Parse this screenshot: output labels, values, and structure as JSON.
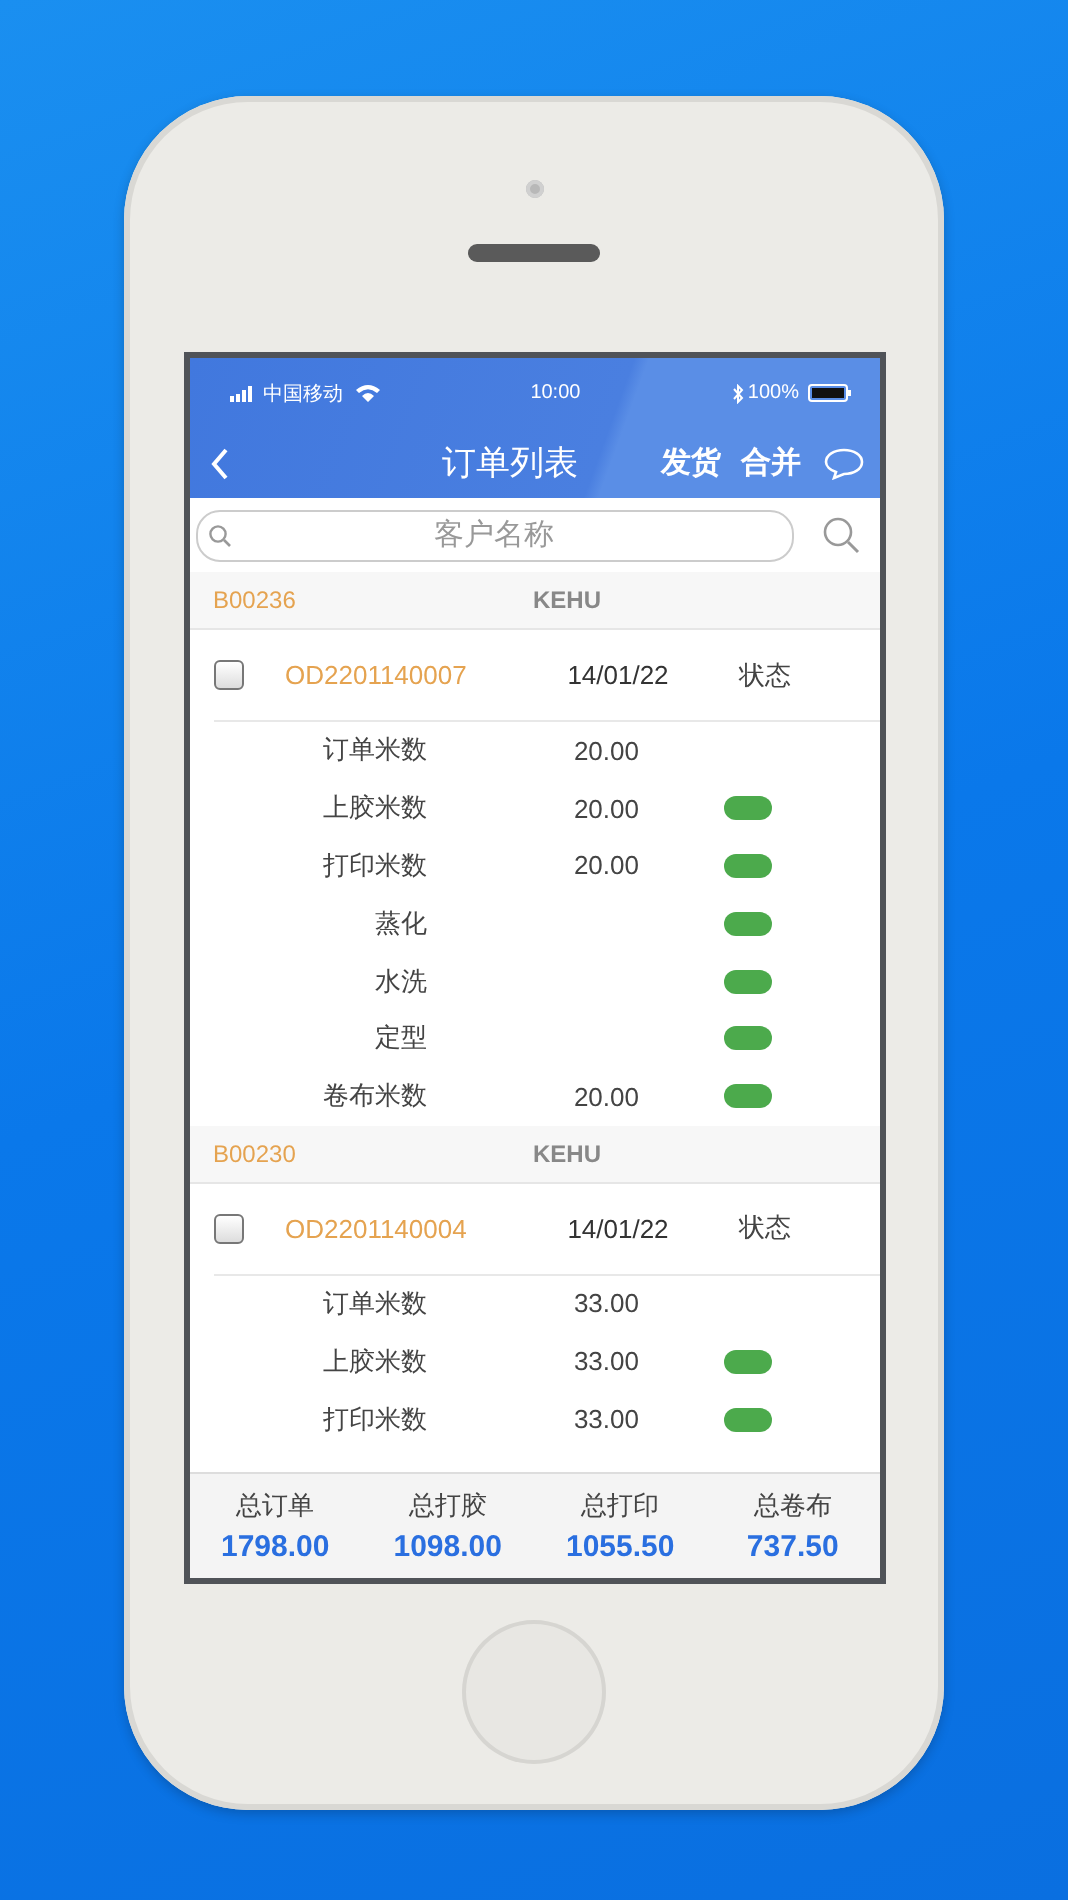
{
  "status_bar": {
    "carrier": "中国移动",
    "time": "10:00",
    "battery": "100%"
  },
  "nav": {
    "title": "订单列表",
    "actions": [
      "发货",
      "合并"
    ]
  },
  "search": {
    "placeholder": "客户名称"
  },
  "groups": [
    {
      "code": "B00236",
      "customer": "KEHU",
      "order": {
        "number": "OD2201140007",
        "date": "14/01/22",
        "status_label": "状态",
        "checked": false
      },
      "rows": [
        {
          "label": "订单米数",
          "value": "20.00",
          "done": false
        },
        {
          "label": "上胶米数",
          "value": "20.00",
          "done": true
        },
        {
          "label": "打印米数",
          "value": "20.00",
          "done": true
        },
        {
          "label": "蒸化",
          "done": true
        },
        {
          "label": "水洗",
          "done": true
        },
        {
          "label": "定型",
          "done": true
        },
        {
          "label": "卷布米数",
          "value": "20.00",
          "done": true
        }
      ]
    },
    {
      "code": "B00230",
      "customer": "KEHU",
      "order": {
        "number": "OD2201140004",
        "date": "14/01/22",
        "status_label": "状态",
        "checked": false
      },
      "rows": [
        {
          "label": "订单米数",
          "value": "33.00",
          "done": false
        },
        {
          "label": "上胶米数",
          "value": "33.00",
          "done": true
        },
        {
          "label": "打印米数",
          "value": "33.00",
          "done": true
        }
      ]
    }
  ],
  "totals": [
    {
      "label": "总订单",
      "value": "1798.00"
    },
    {
      "label": "总打胶",
      "value": "1098.00"
    },
    {
      "label": "总打印",
      "value": "1055.50"
    },
    {
      "label": "总卷布",
      "value": "737.50"
    }
  ]
}
